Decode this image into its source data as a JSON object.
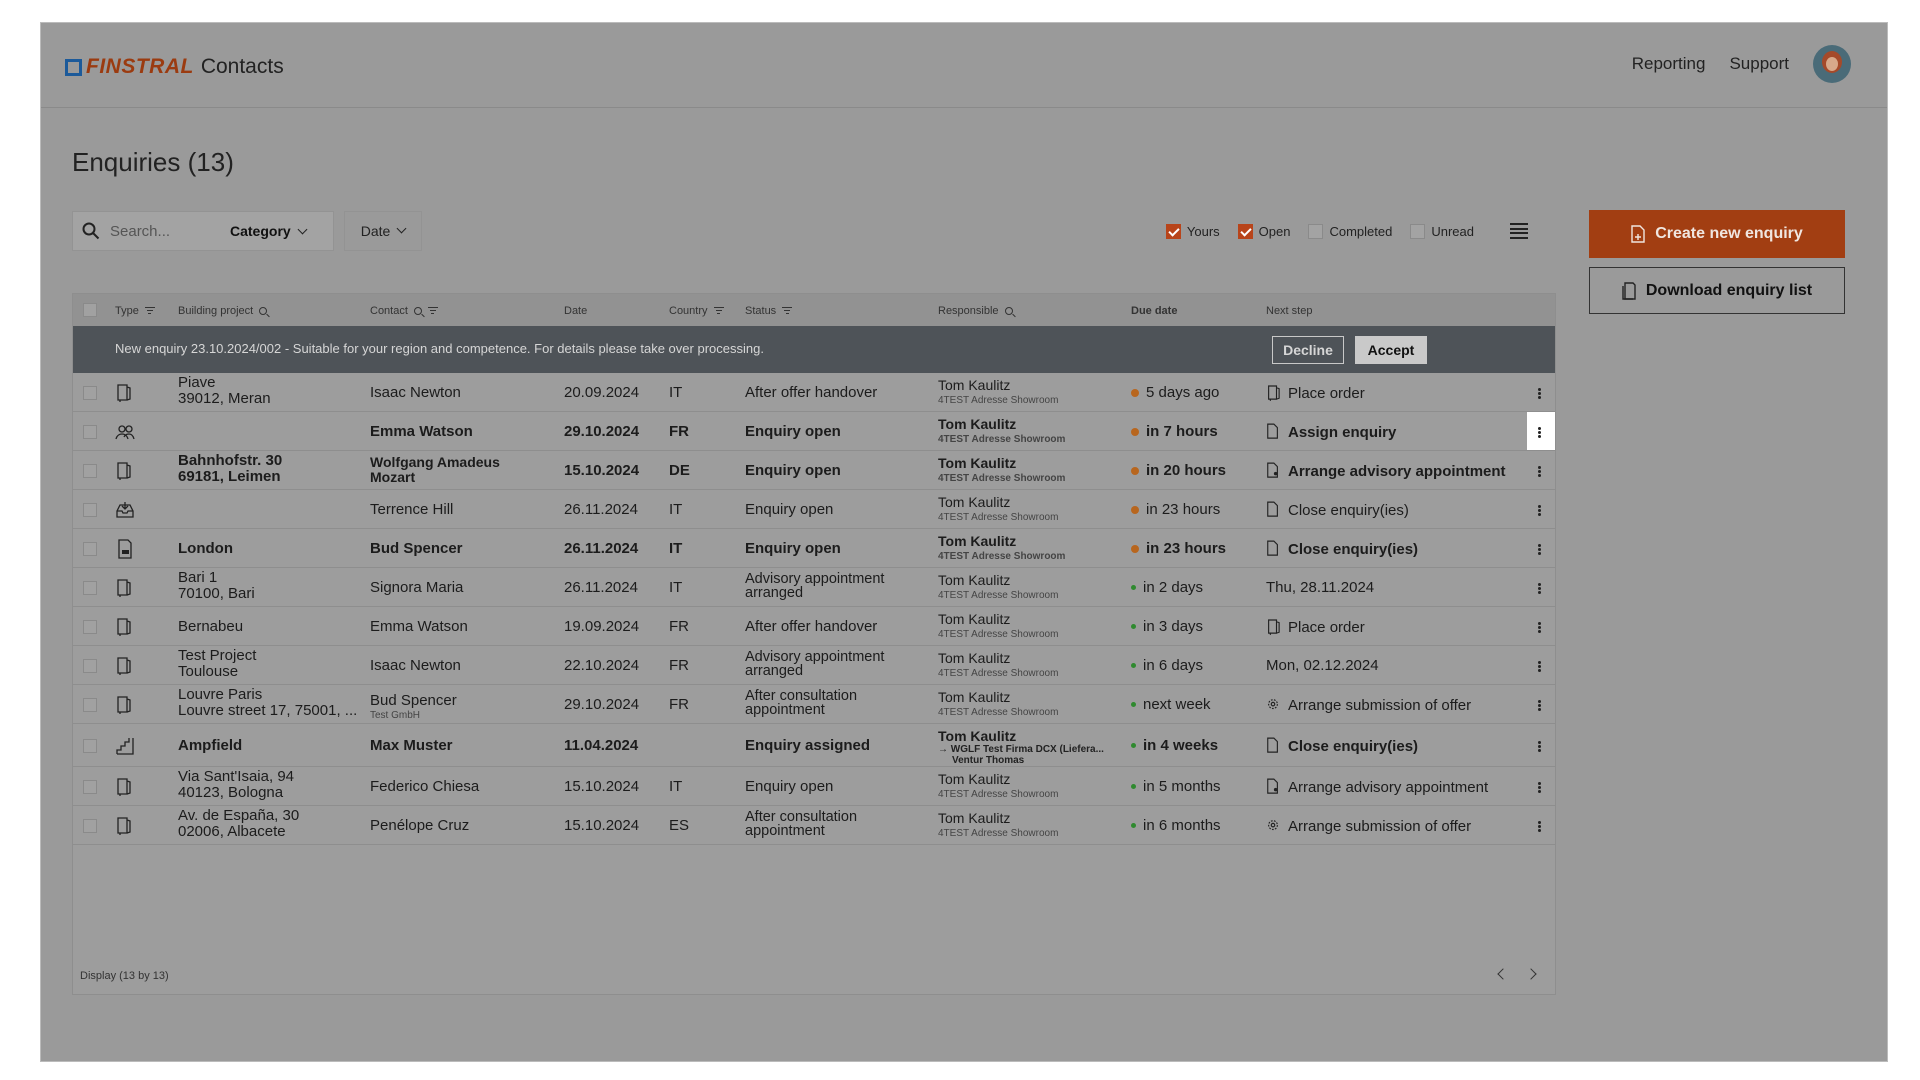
{
  "brand": {
    "logo_text": "FINSTRAL",
    "app_name": "Contacts"
  },
  "nav": {
    "reporting": "Reporting",
    "support": "Support"
  },
  "page": {
    "title": "Enquiries (13)"
  },
  "toolbar": {
    "search_placeholder": "Search...",
    "category_label": "Category",
    "date_label": "Date",
    "filters": [
      {
        "label": "Yours",
        "checked": true
      },
      {
        "label": "Open",
        "checked": true
      },
      {
        "label": "Completed",
        "checked": false
      },
      {
        "label": "Unread",
        "checked": false
      }
    ]
  },
  "actions": {
    "create": "Create new enquiry",
    "download": "Download enquiry list"
  },
  "columns": {
    "type": "Type",
    "building": "Building project",
    "contact": "Contact",
    "date": "Date",
    "country": "Country",
    "status": "Status",
    "responsible": "Responsible",
    "due": "Due date",
    "next": "Next step"
  },
  "banner": {
    "message": "New enquiry 23.10.2024/002 - Suitable for your region and competence. For details please take over processing.",
    "decline": "Decline",
    "accept": "Accept"
  },
  "colors": {
    "orange": "#b8661e",
    "green": "#2f8a2f",
    "brand": "#a23e12"
  },
  "rows": [
    {
      "icon": "door-icon",
      "bp1": "Piave",
      "bp2": "39012, Meran",
      "contact": "Isaac Newton",
      "contact_sub": "",
      "date": "20.09.2024",
      "country": "IT",
      "status": "After offer handover",
      "resp": "Tom Kaulitz",
      "resp_sub": "4TEST Adresse Showroom",
      "due": "5 days ago",
      "due_color": "orange",
      "next": "Place order",
      "next_icon": "door-icon",
      "bold": false
    },
    {
      "icon": "people-icon",
      "bp1": "",
      "bp2": "",
      "contact": "Emma Watson",
      "contact_sub": "",
      "date": "29.10.2024",
      "country": "FR",
      "status": "Enquiry open",
      "resp": "Tom Kaulitz",
      "resp_sub": "4TEST Adresse Showroom",
      "due": "in 7 hours",
      "due_color": "orange",
      "next": "Assign enquiry",
      "next_icon": "document-icon",
      "bold": true
    },
    {
      "icon": "door-icon",
      "bp1": "Bahnhofstr. 30",
      "bp2": "69181, Leimen",
      "contact": "Wolfgang Amadeus",
      "contact2": "Mozart",
      "contact_sub": "",
      "date": "15.10.2024",
      "country": "DE",
      "status": "Enquiry open",
      "resp": "Tom Kaulitz",
      "resp_sub": "4TEST Adresse Showroom",
      "due": "in 20 hours",
      "due_color": "orange",
      "next": "Arrange advisory appointment",
      "next_icon": "document-person-icon",
      "bold": true
    },
    {
      "icon": "inbox-icon",
      "bp1": "",
      "bp2": "",
      "contact": "Terrence Hill",
      "contact_sub": "",
      "date": "26.11.2024",
      "country": "IT",
      "status": "Enquiry open",
      "resp": "Tom Kaulitz",
      "resp_sub": "4TEST Adresse Showroom",
      "due": "in 23 hours",
      "due_color": "orange",
      "next": "Close enquiry(ies)",
      "next_icon": "document-icon",
      "bold": false
    },
    {
      "icon": "document-web-icon",
      "bp1": "London",
      "bp2": "",
      "contact": "Bud Spencer",
      "contact_sub": "",
      "date": "26.11.2024",
      "country": "IT",
      "status": "Enquiry open",
      "resp": "Tom Kaulitz",
      "resp_sub": "4TEST Adresse Showroom",
      "due": "in 23 hours",
      "due_color": "orange",
      "next": "Close enquiry(ies)",
      "next_icon": "document-icon",
      "bold": true
    },
    {
      "icon": "door-icon",
      "bp1": "Bari 1",
      "bp2": "70100, Bari",
      "contact": "Signora Maria",
      "contact_sub": "",
      "date": "26.11.2024",
      "country": "IT",
      "status": "Advisory appointment",
      "status2": "arranged",
      "resp": "Tom Kaulitz",
      "resp_sub": "4TEST Adresse Showroom",
      "due": "in 2 days",
      "due_color": "green",
      "next": "Thu, 28.11.2024",
      "next_icon": "",
      "bold": false
    },
    {
      "icon": "door-icon",
      "bp1": "Bernabeu",
      "bp2": "",
      "contact": "Emma Watson",
      "contact_sub": "",
      "date": "19.09.2024",
      "country": "FR",
      "status": "After offer handover",
      "resp": "Tom Kaulitz",
      "resp_sub": "4TEST Adresse Showroom",
      "due": "in 3 days",
      "due_color": "green",
      "next": "Place order",
      "next_icon": "door-icon",
      "bold": false
    },
    {
      "icon": "door-icon",
      "bp1": "Test Project",
      "bp2": "Toulouse",
      "contact": "Isaac Newton",
      "contact_sub": "",
      "date": "22.10.2024",
      "country": "FR",
      "status": "Advisory appointment",
      "status2": "arranged",
      "resp": "Tom Kaulitz",
      "resp_sub": "4TEST Adresse Showroom",
      "due": "in 6 days",
      "due_color": "green",
      "next": "Mon, 02.12.2024",
      "next_icon": "",
      "bold": false
    },
    {
      "icon": "door-icon",
      "bp1": "Louvre Paris",
      "bp2": "Louvre street 17, 75001, ...",
      "contact": "Bud Spencer",
      "contact_sub": "Test GmbH",
      "date": "29.10.2024",
      "country": "FR",
      "status": "After consultation",
      "status2": "appointment",
      "resp": "Tom Kaulitz",
      "resp_sub": "4TEST Adresse Showroom",
      "due": "next week",
      "due_color": "green",
      "next": "Arrange submission of offer",
      "next_icon": "gear-person-icon",
      "bold": false
    },
    {
      "icon": "stairs-icon",
      "bp1": "Ampfield",
      "bp2": "",
      "contact": "Max Muster",
      "contact_sub": "",
      "date": "11.04.2024",
      "country": "",
      "status": "Enquiry assigned",
      "resp": "Tom Kaulitz",
      "resp_sub": "→ WGLF Test Firma DCX (Liefera...",
      "resp_sub2": "Ventur Thomas",
      "due": "in 4 weeks",
      "due_color": "green",
      "next": "Close enquiry(ies)",
      "next_icon": "document-icon",
      "bold": true
    },
    {
      "icon": "door-icon",
      "bp1": "Via Sant'Isaia, 94",
      "bp2": "40123, Bologna",
      "contact": "Federico Chiesa",
      "contact_sub": "",
      "date": "15.10.2024",
      "country": "IT",
      "status": "Enquiry open",
      "resp": "Tom Kaulitz",
      "resp_sub": "4TEST Adresse Showroom",
      "due": "in 5 months",
      "due_color": "green",
      "next": "Arrange advisory appointment",
      "next_icon": "document-person-icon",
      "bold": false
    },
    {
      "icon": "door-icon",
      "bp1": "Av. de España, 30",
      "bp2": "02006, Albacete",
      "contact": "Penélope Cruz",
      "contact_sub": "",
      "date": "15.10.2024",
      "country": "ES",
      "status": "After consultation",
      "status2": "appointment",
      "resp": "Tom Kaulitz",
      "resp_sub": "4TEST Adresse Showroom",
      "due": "in 6 months",
      "due_color": "green",
      "next": "Arrange submission of offer",
      "next_icon": "gear-person-icon",
      "bold": false
    }
  ],
  "footer": {
    "display": "Display  (13 by 13)"
  }
}
